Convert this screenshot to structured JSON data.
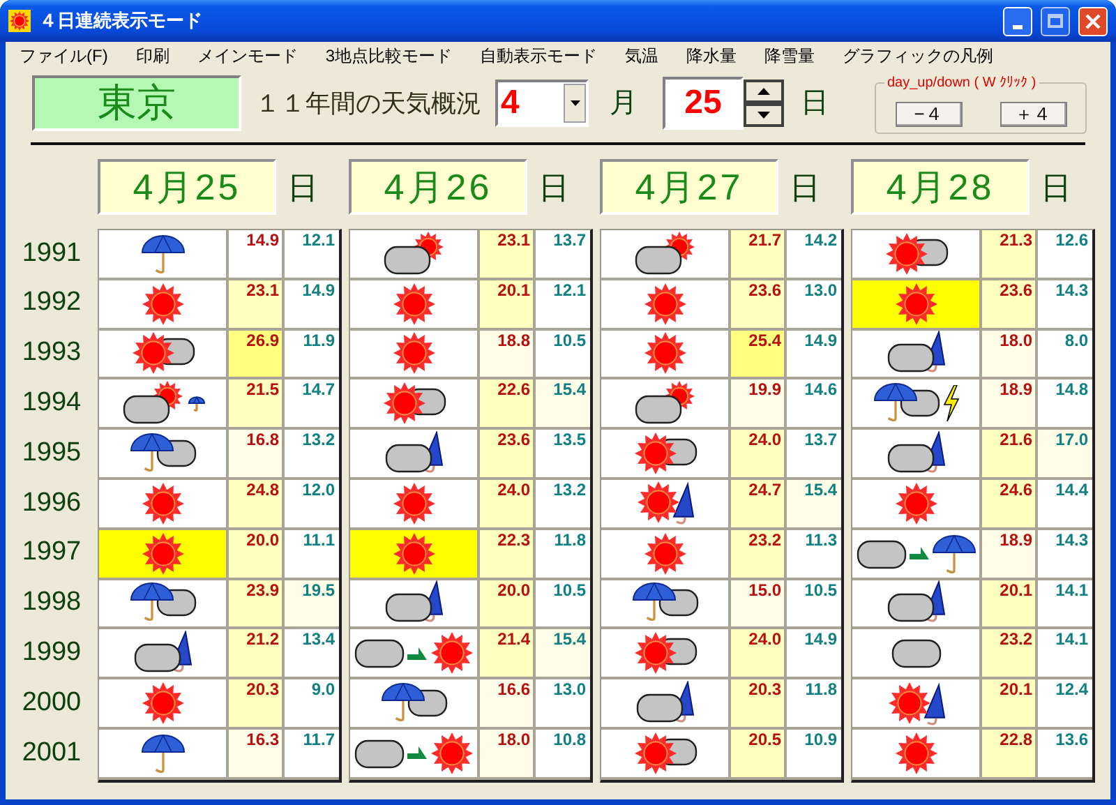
{
  "window": {
    "title": "４日連続表示モード"
  },
  "menu": [
    "ファイル(F)",
    "印刷",
    "メインモード",
    "3地点比較モード",
    "自動表示モード",
    "気温",
    "降水量",
    "降雪量",
    "グラフィックの凡例"
  ],
  "location": "東京",
  "summary_label": "１１年間の天気概況",
  "month": {
    "value": "4",
    "unit": "月"
  },
  "day": {
    "value": "25",
    "unit": "日"
  },
  "day_shift": {
    "legend": "day_up/down ( W ｸﾘｯｸ )",
    "buttons": [
      "−４",
      "＋４"
    ]
  },
  "years": [
    "1991",
    "1992",
    "1993",
    "1994",
    "1995",
    "1996",
    "1997",
    "1998",
    "1999",
    "2000",
    "2001"
  ],
  "days": [
    {
      "date": "4月25",
      "unit": "日",
      "rows": [
        {
          "weather": [
            {
              "kind": "umbrella"
            }
          ],
          "highlight": false,
          "high": {
            "text": "14.9",
            "color": "#ffffff"
          },
          "low": {
            "text": "12.1",
            "color": "#ffffff"
          }
        },
        {
          "weather": [
            {
              "kind": "sun"
            }
          ],
          "highlight": false,
          "high": {
            "text": "23.1",
            "color": "#ffffc0"
          },
          "low": {
            "text": "14.9",
            "color": "#ffffff"
          }
        },
        {
          "weather": [
            {
              "kind": "sun_cloud"
            }
          ],
          "highlight": false,
          "high": {
            "text": "26.9",
            "color": "#ffff80"
          },
          "low": {
            "text": "11.9",
            "color": "#ffffff"
          }
        },
        {
          "weather": [
            {
              "kind": "cloud_sun"
            },
            {
              "kind": "umbrella_small"
            }
          ],
          "highlight": false,
          "high": {
            "text": "21.5",
            "color": "#ffffc0"
          },
          "low": {
            "text": "14.7",
            "color": "#ffffff"
          }
        },
        {
          "weather": [
            {
              "kind": "umbrella_cloud"
            }
          ],
          "highlight": false,
          "high": {
            "text": "16.8",
            "color": "#fffde8"
          },
          "low": {
            "text": "13.2",
            "color": "#ffffff"
          }
        },
        {
          "weather": [
            {
              "kind": "sun"
            }
          ],
          "highlight": false,
          "high": {
            "text": "24.8",
            "color": "#ffffc0"
          },
          "low": {
            "text": "12.0",
            "color": "#ffffff"
          }
        },
        {
          "weather": [
            {
              "kind": "sun"
            }
          ],
          "highlight": true,
          "high": {
            "text": "20.0",
            "color": "#ffffc0"
          },
          "low": {
            "text": "11.1",
            "color": "#ffffff"
          }
        },
        {
          "weather": [
            {
              "kind": "umbrella_cloud"
            }
          ],
          "highlight": false,
          "high": {
            "text": "23.9",
            "color": "#ffffc0"
          },
          "low": {
            "text": "19.5",
            "color": "#fffde8"
          }
        },
        {
          "weather": [
            {
              "kind": "cloud_umbrella"
            }
          ],
          "highlight": false,
          "high": {
            "text": "21.2",
            "color": "#ffffc0"
          },
          "low": {
            "text": "13.4",
            "color": "#ffffff"
          }
        },
        {
          "weather": [
            {
              "kind": "sun"
            }
          ],
          "highlight": false,
          "high": {
            "text": "20.3",
            "color": "#ffffc0"
          },
          "low": {
            "text": "9.0",
            "color": "#ffffff"
          }
        },
        {
          "weather": [
            {
              "kind": "umbrella"
            }
          ],
          "highlight": false,
          "high": {
            "text": "16.3",
            "color": "#fffde8"
          },
          "low": {
            "text": "11.7",
            "color": "#ffffff"
          }
        }
      ]
    },
    {
      "date": "4月26",
      "unit": "日",
      "rows": [
        {
          "weather": [
            {
              "kind": "cloud_sun"
            }
          ],
          "highlight": false,
          "high": {
            "text": "23.1",
            "color": "#ffffc0"
          },
          "low": {
            "text": "13.7",
            "color": "#ffffff"
          }
        },
        {
          "weather": [
            {
              "kind": "sun"
            }
          ],
          "highlight": false,
          "high": {
            "text": "20.1",
            "color": "#ffffc0"
          },
          "low": {
            "text": "12.1",
            "color": "#ffffff"
          }
        },
        {
          "weather": [
            {
              "kind": "sun"
            }
          ],
          "highlight": false,
          "high": {
            "text": "18.8",
            "color": "#fffde8"
          },
          "low": {
            "text": "10.5",
            "color": "#ffffff"
          }
        },
        {
          "weather": [
            {
              "kind": "sun_cloud"
            }
          ],
          "highlight": false,
          "high": {
            "text": "22.6",
            "color": "#ffffc0"
          },
          "low": {
            "text": "15.4",
            "color": "#fffde8"
          }
        },
        {
          "weather": [
            {
              "kind": "cloud_umbrella"
            }
          ],
          "highlight": false,
          "high": {
            "text": "23.6",
            "color": "#ffffc0"
          },
          "low": {
            "text": "13.5",
            "color": "#ffffff"
          }
        },
        {
          "weather": [
            {
              "kind": "sun"
            }
          ],
          "highlight": false,
          "high": {
            "text": "24.0",
            "color": "#ffffc0"
          },
          "low": {
            "text": "13.2",
            "color": "#ffffff"
          }
        },
        {
          "weather": [
            {
              "kind": "sun"
            }
          ],
          "highlight": true,
          "high": {
            "text": "22.3",
            "color": "#ffffc0"
          },
          "low": {
            "text": "11.8",
            "color": "#ffffff"
          }
        },
        {
          "weather": [
            {
              "kind": "cloud_umbrella"
            }
          ],
          "highlight": false,
          "high": {
            "text": "20.0",
            "color": "#ffffc0"
          },
          "low": {
            "text": "10.5",
            "color": "#ffffff"
          }
        },
        {
          "weather": [
            {
              "kind": "cloud"
            },
            {
              "kind": "arrow"
            },
            {
              "kind": "sun"
            }
          ],
          "highlight": false,
          "high": {
            "text": "21.4",
            "color": "#ffffc0"
          },
          "low": {
            "text": "15.4",
            "color": "#fffde8"
          }
        },
        {
          "weather": [
            {
              "kind": "umbrella_cloud"
            }
          ],
          "highlight": false,
          "high": {
            "text": "16.6",
            "color": "#fffde8"
          },
          "low": {
            "text": "13.0",
            "color": "#ffffff"
          }
        },
        {
          "weather": [
            {
              "kind": "cloud"
            },
            {
              "kind": "arrow"
            },
            {
              "kind": "sun"
            }
          ],
          "highlight": false,
          "high": {
            "text": "18.0",
            "color": "#fffde8"
          },
          "low": {
            "text": "10.8",
            "color": "#ffffff"
          }
        }
      ]
    },
    {
      "date": "4月27",
      "unit": "日",
      "rows": [
        {
          "weather": [
            {
              "kind": "cloud_sun"
            }
          ],
          "highlight": false,
          "high": {
            "text": "21.7",
            "color": "#ffffc0"
          },
          "low": {
            "text": "14.2",
            "color": "#ffffff"
          }
        },
        {
          "weather": [
            {
              "kind": "sun"
            }
          ],
          "highlight": false,
          "high": {
            "text": "23.6",
            "color": "#ffffc0"
          },
          "low": {
            "text": "13.0",
            "color": "#ffffff"
          }
        },
        {
          "weather": [
            {
              "kind": "sun"
            }
          ],
          "highlight": false,
          "high": {
            "text": "25.4",
            "color": "#ffff80"
          },
          "low": {
            "text": "14.9",
            "color": "#ffffff"
          }
        },
        {
          "weather": [
            {
              "kind": "cloud_sun"
            }
          ],
          "highlight": false,
          "high": {
            "text": "19.9",
            "color": "#fffde8"
          },
          "low": {
            "text": "14.6",
            "color": "#ffffff"
          }
        },
        {
          "weather": [
            {
              "kind": "sun_cloud"
            }
          ],
          "highlight": false,
          "high": {
            "text": "24.0",
            "color": "#ffffc0"
          },
          "low": {
            "text": "13.7",
            "color": "#ffffff"
          }
        },
        {
          "weather": [
            {
              "kind": "sun_umbrella"
            }
          ],
          "highlight": false,
          "high": {
            "text": "24.7",
            "color": "#ffffc0"
          },
          "low": {
            "text": "15.4",
            "color": "#fffde8"
          }
        },
        {
          "weather": [
            {
              "kind": "sun"
            }
          ],
          "highlight": false,
          "high": {
            "text": "23.2",
            "color": "#ffffc0"
          },
          "low": {
            "text": "11.3",
            "color": "#ffffff"
          }
        },
        {
          "weather": [
            {
              "kind": "umbrella_cloud"
            }
          ],
          "highlight": false,
          "high": {
            "text": "15.0",
            "color": "#fffde8"
          },
          "low": {
            "text": "10.5",
            "color": "#ffffff"
          }
        },
        {
          "weather": [
            {
              "kind": "sun_cloud"
            }
          ],
          "highlight": false,
          "high": {
            "text": "24.0",
            "color": "#ffffc0"
          },
          "low": {
            "text": "14.9",
            "color": "#ffffff"
          }
        },
        {
          "weather": [
            {
              "kind": "cloud_umbrella"
            }
          ],
          "highlight": false,
          "high": {
            "text": "20.3",
            "color": "#ffffc0"
          },
          "low": {
            "text": "11.8",
            "color": "#ffffff"
          }
        },
        {
          "weather": [
            {
              "kind": "sun_cloud"
            }
          ],
          "highlight": false,
          "high": {
            "text": "20.5",
            "color": "#ffffc0"
          },
          "low": {
            "text": "10.9",
            "color": "#ffffff"
          }
        }
      ]
    },
    {
      "date": "4月28",
      "unit": "日",
      "rows": [
        {
          "weather": [
            {
              "kind": "sun_cloud"
            }
          ],
          "highlight": false,
          "high": {
            "text": "21.3",
            "color": "#ffffc0"
          },
          "low": {
            "text": "12.6",
            "color": "#ffffff"
          }
        },
        {
          "weather": [
            {
              "kind": "sun"
            }
          ],
          "highlight": true,
          "high": {
            "text": "23.6",
            "color": "#ffffc0"
          },
          "low": {
            "text": "14.3",
            "color": "#ffffff"
          }
        },
        {
          "weather": [
            {
              "kind": "cloud_umbrella"
            }
          ],
          "highlight": false,
          "high": {
            "text": "18.0",
            "color": "#fffde8"
          },
          "low": {
            "text": "8.0",
            "color": "#ffffff"
          }
        },
        {
          "weather": [
            {
              "kind": "umbrella_cloud"
            },
            {
              "kind": "thunder"
            }
          ],
          "highlight": false,
          "high": {
            "text": "18.9",
            "color": "#fffde8"
          },
          "low": {
            "text": "14.8",
            "color": "#ffffff"
          }
        },
        {
          "weather": [
            {
              "kind": "cloud_umbrella"
            }
          ],
          "highlight": false,
          "high": {
            "text": "21.6",
            "color": "#ffffc0"
          },
          "low": {
            "text": "17.0",
            "color": "#fffde8"
          }
        },
        {
          "weather": [
            {
              "kind": "sun"
            }
          ],
          "highlight": false,
          "high": {
            "text": "24.6",
            "color": "#ffffc0"
          },
          "low": {
            "text": "14.4",
            "color": "#ffffff"
          }
        },
        {
          "weather": [
            {
              "kind": "cloud"
            },
            {
              "kind": "arrow"
            },
            {
              "kind": "umbrella"
            }
          ],
          "highlight": false,
          "high": {
            "text": "18.9",
            "color": "#fffde8"
          },
          "low": {
            "text": "14.3",
            "color": "#ffffff"
          }
        },
        {
          "weather": [
            {
              "kind": "cloud_umbrella"
            }
          ],
          "highlight": false,
          "high": {
            "text": "20.1",
            "color": "#ffffc0"
          },
          "low": {
            "text": "14.1",
            "color": "#ffffff"
          }
        },
        {
          "weather": [
            {
              "kind": "cloud"
            }
          ],
          "highlight": false,
          "high": {
            "text": "23.2",
            "color": "#ffffc0"
          },
          "low": {
            "text": "14.1",
            "color": "#ffffff"
          }
        },
        {
          "weather": [
            {
              "kind": "sun_umbrella"
            }
          ],
          "highlight": false,
          "high": {
            "text": "20.1",
            "color": "#ffffc0"
          },
          "low": {
            "text": "12.4",
            "color": "#ffffff"
          }
        },
        {
          "weather": [
            {
              "kind": "sun"
            }
          ],
          "highlight": false,
          "high": {
            "text": "22.8",
            "color": "#ffffc0"
          },
          "low": {
            "text": "13.6",
            "color": "#ffffff"
          }
        }
      ]
    }
  ]
}
